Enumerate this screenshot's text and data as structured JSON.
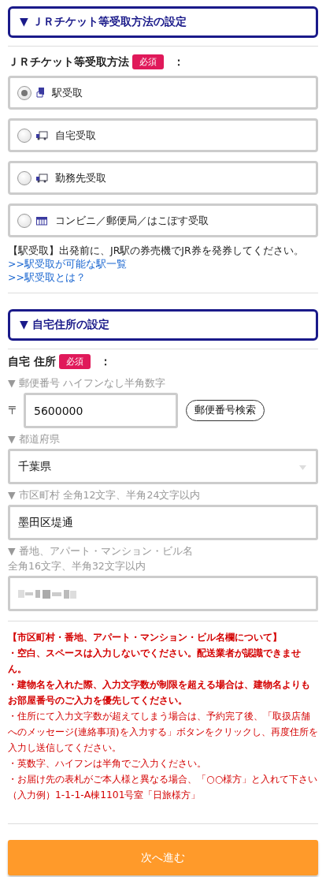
{
  "sections": [
    {
      "title": "▼ ＪＲチケット等受取方法の設定",
      "kind": "method",
      "label": "ＪＲチケット等受取方法",
      "badge": "必須",
      "colon": "：",
      "options": [
        {
          "label": "駅受取",
          "kind": "station",
          "selected": true
        },
        {
          "label": "自宅受取",
          "kind": "delivery",
          "selected": false
        },
        {
          "label": "勤務先受取",
          "kind": "delivery",
          "selected": false
        },
        {
          "label": "コンビニ／郵便局／はこぽす受取",
          "kind": "store",
          "selected": false
        }
      ],
      "note": "【駅受取】出発前に、JR駅の券売機でJR券を発券してください。",
      "links": [
        ">>駅受取が可能な駅一覧",
        ">>駅受取とは？"
      ]
    },
    {
      "title": "▼ 自宅住所の設定",
      "kind": "address",
      "label": "自宅 住所",
      "badge": "必須",
      "colon": "：",
      "postal": {
        "hint": "▼ 郵便番号 ハイフンなし半角数字",
        "mark": "〒",
        "value": "5600000",
        "button": "郵便番号検索"
      },
      "prefecture": {
        "hint": "▼ 都道府県",
        "value": "千葉県"
      },
      "city": {
        "hint": "▼ 市区町村 全角12文字、半角24文字以内",
        "value": "墨田区堤通"
      },
      "street": {
        "hint": "▼ 番地、アパート・マンション・ビル名",
        "hint2": "全角16文字、半角32文字以内"
      },
      "notes": [
        {
          "text": "【市区町村・番地、アパート・マンション・ビル名欄について】",
          "bold": true
        },
        {
          "text": "・空白、スペースは入力しないでください。配送業者が認識できません。",
          "bold": true
        },
        {
          "text": "・建物名を入れた際、入力文字数が制限を超える場合は、建物名よりもお部屋番号のご入力を優先してください。",
          "bold": true
        },
        {
          "text": "・住所にて入力文字数が超えてしまう場合は、予約完了後、「取扱店舗へのメッセージ(連絡事項)を入力する」ボタンをクリックし、再度住所を入力し送信してください。",
          "bold": false
        },
        {
          "text": "・英数字、ハイフンは半角でご入力ください。",
          "bold": false
        },
        {
          "text": "・お届け先の表札がご本人様と異なる場合、「○○様方」と入れて下さい",
          "bold": false
        },
        {
          "text": "（入力例）1-1-1-A棟1101号室「日旅様方」",
          "bold": false
        }
      ]
    }
  ],
  "next_button": "次へ進む"
}
